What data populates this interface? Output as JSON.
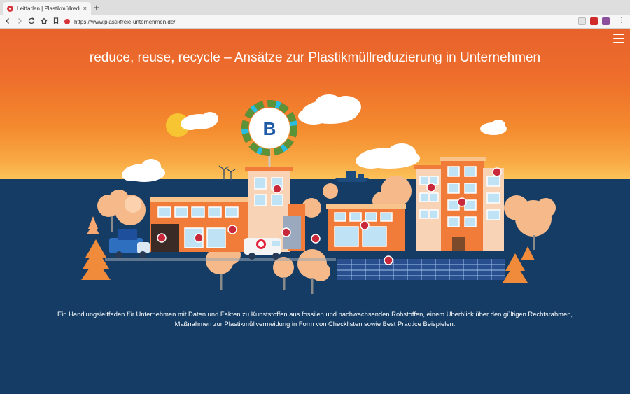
{
  "browser": {
    "tab_title": "Leitfaden | Plastikmüllreduzierun",
    "tab_close": "×",
    "new_tab": "+",
    "url": "https://www.plastikfreie-unternehmen.de/",
    "menu_glyph": "⋮"
  },
  "page": {
    "headline": "reduce, reuse, recycle – Ansätze zur Plastikmüllreduzierung in Unternehmen",
    "lead": "Ein Handlungsleitfaden für Unternehmen mit Daten und Fakten zu Kunststoffen aus fossilen und nachwachsenden Rohstoffen, einem Überblick über den gültigen Rechtsrahmen, Maßnahmen zur Plastikmüllvermeidung in Form von Checklisten sowie Best Practice Beispielen.",
    "logo_letter": "B"
  },
  "colors": {
    "sky_top": "#e8622c",
    "sky_bottom": "#fcc25a",
    "ground": "#143c64",
    "building": "#f17c3a",
    "accent_red": "#c8283a"
  }
}
